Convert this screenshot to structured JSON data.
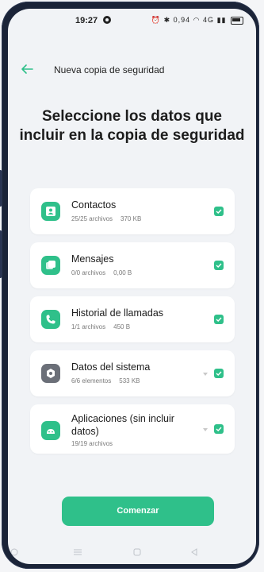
{
  "status_bar": {
    "time": "19:27",
    "speed": "0,94",
    "network": "4G"
  },
  "header": {
    "title": "Nueva copia de seguridad"
  },
  "headline": "Seleccione los datos que incluir en la copia de seguridad",
  "items": [
    {
      "name": "Contactos",
      "count": "25/25 archivos",
      "size": "370 KB",
      "icon": "contacts-icon",
      "icon_color": "#2fc08a",
      "checked": true
    },
    {
      "name": "Mensajes",
      "count": "0/0 archivos",
      "size": "0,00 B",
      "icon": "messages-icon",
      "icon_color": "#2fc08a",
      "checked": true
    },
    {
      "name": "Historial de llamadas",
      "count": "1/1 archivos",
      "size": "450 B",
      "icon": "phone-icon",
      "icon_color": "#2fc08a",
      "checked": true
    },
    {
      "name": "Datos del sistema",
      "count": "6/6 elementos",
      "size": "533 KB",
      "icon": "settings-icon",
      "icon_color": "#6b6f78",
      "checked": true
    },
    {
      "name": "Aplicaciones (sin incluir datos)",
      "count": "19/19 archivos",
      "size": "",
      "icon": "apps-icon",
      "icon_color": "#2fc08a",
      "checked": true
    }
  ],
  "start_button": "Comenzar",
  "colors": {
    "accent": "#2fc08a",
    "background": "#f1f3f6"
  }
}
